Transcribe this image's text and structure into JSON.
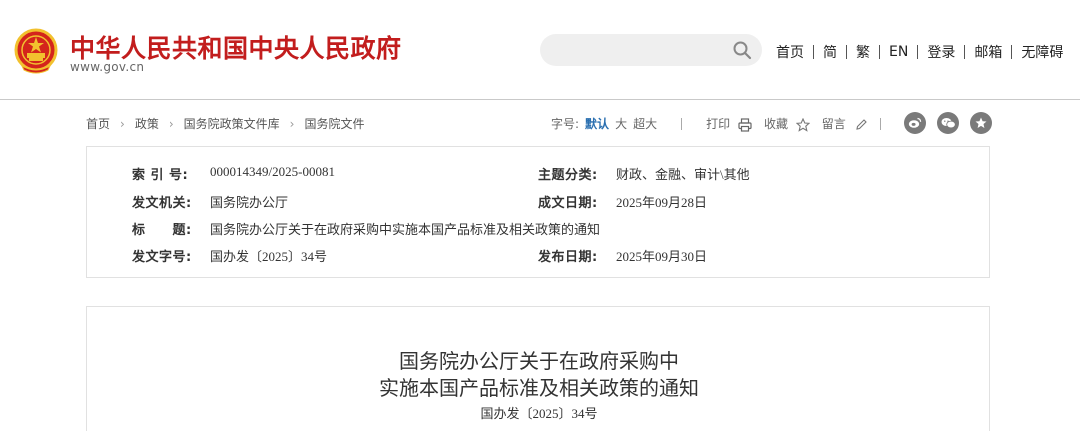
{
  "header": {
    "site_title": "中华人民共和国中央人民政府",
    "site_url": "www.gov.cn",
    "search_placeholder": "",
    "nav": [
      "首页",
      "简",
      "繁",
      "EN",
      "登录",
      "邮箱",
      "无障碍"
    ]
  },
  "breadcrumb": [
    "首页",
    "政策",
    "国务院政策文件库",
    "国务院文件"
  ],
  "tools": {
    "font_size_label": "字号:",
    "font_default": "默认",
    "font_large": "大",
    "font_xlarge": "超大",
    "print": "打印",
    "favorite": "收藏",
    "comment": "留言"
  },
  "share_icons": [
    "weibo-icon",
    "wechat-icon",
    "star-icon"
  ],
  "meta": {
    "index_label": "索 引 号:",
    "index_value": "000014349/2025-00081",
    "category_label": "主题分类:",
    "category_value": "财政、金融、审计\\其他",
    "issuer_label": "发文机关:",
    "issuer_value": "国务院办公厅",
    "date_written_label": "成文日期:",
    "date_written_value": "2025年09月28日",
    "title_label": "标　　题:",
    "title_value": "国务院办公厅关于在政府采购中实施本国产品标准及相关政策的通知",
    "docno_label": "发文字号:",
    "docno_value": "国办发〔2025〕34号",
    "publish_label": "发布日期:",
    "publish_value": "2025年09月30日"
  },
  "article": {
    "title_line1": "国务院办公厅关于在政府采购中",
    "title_line2": "实施本国产品标准及相关政策的通知",
    "doc_number": "国办发〔2025〕34号"
  },
  "colors": {
    "brand_red": "#c21d1d",
    "link_blue": "#2a6fb0",
    "emblem_gold": "#f2c12e"
  }
}
